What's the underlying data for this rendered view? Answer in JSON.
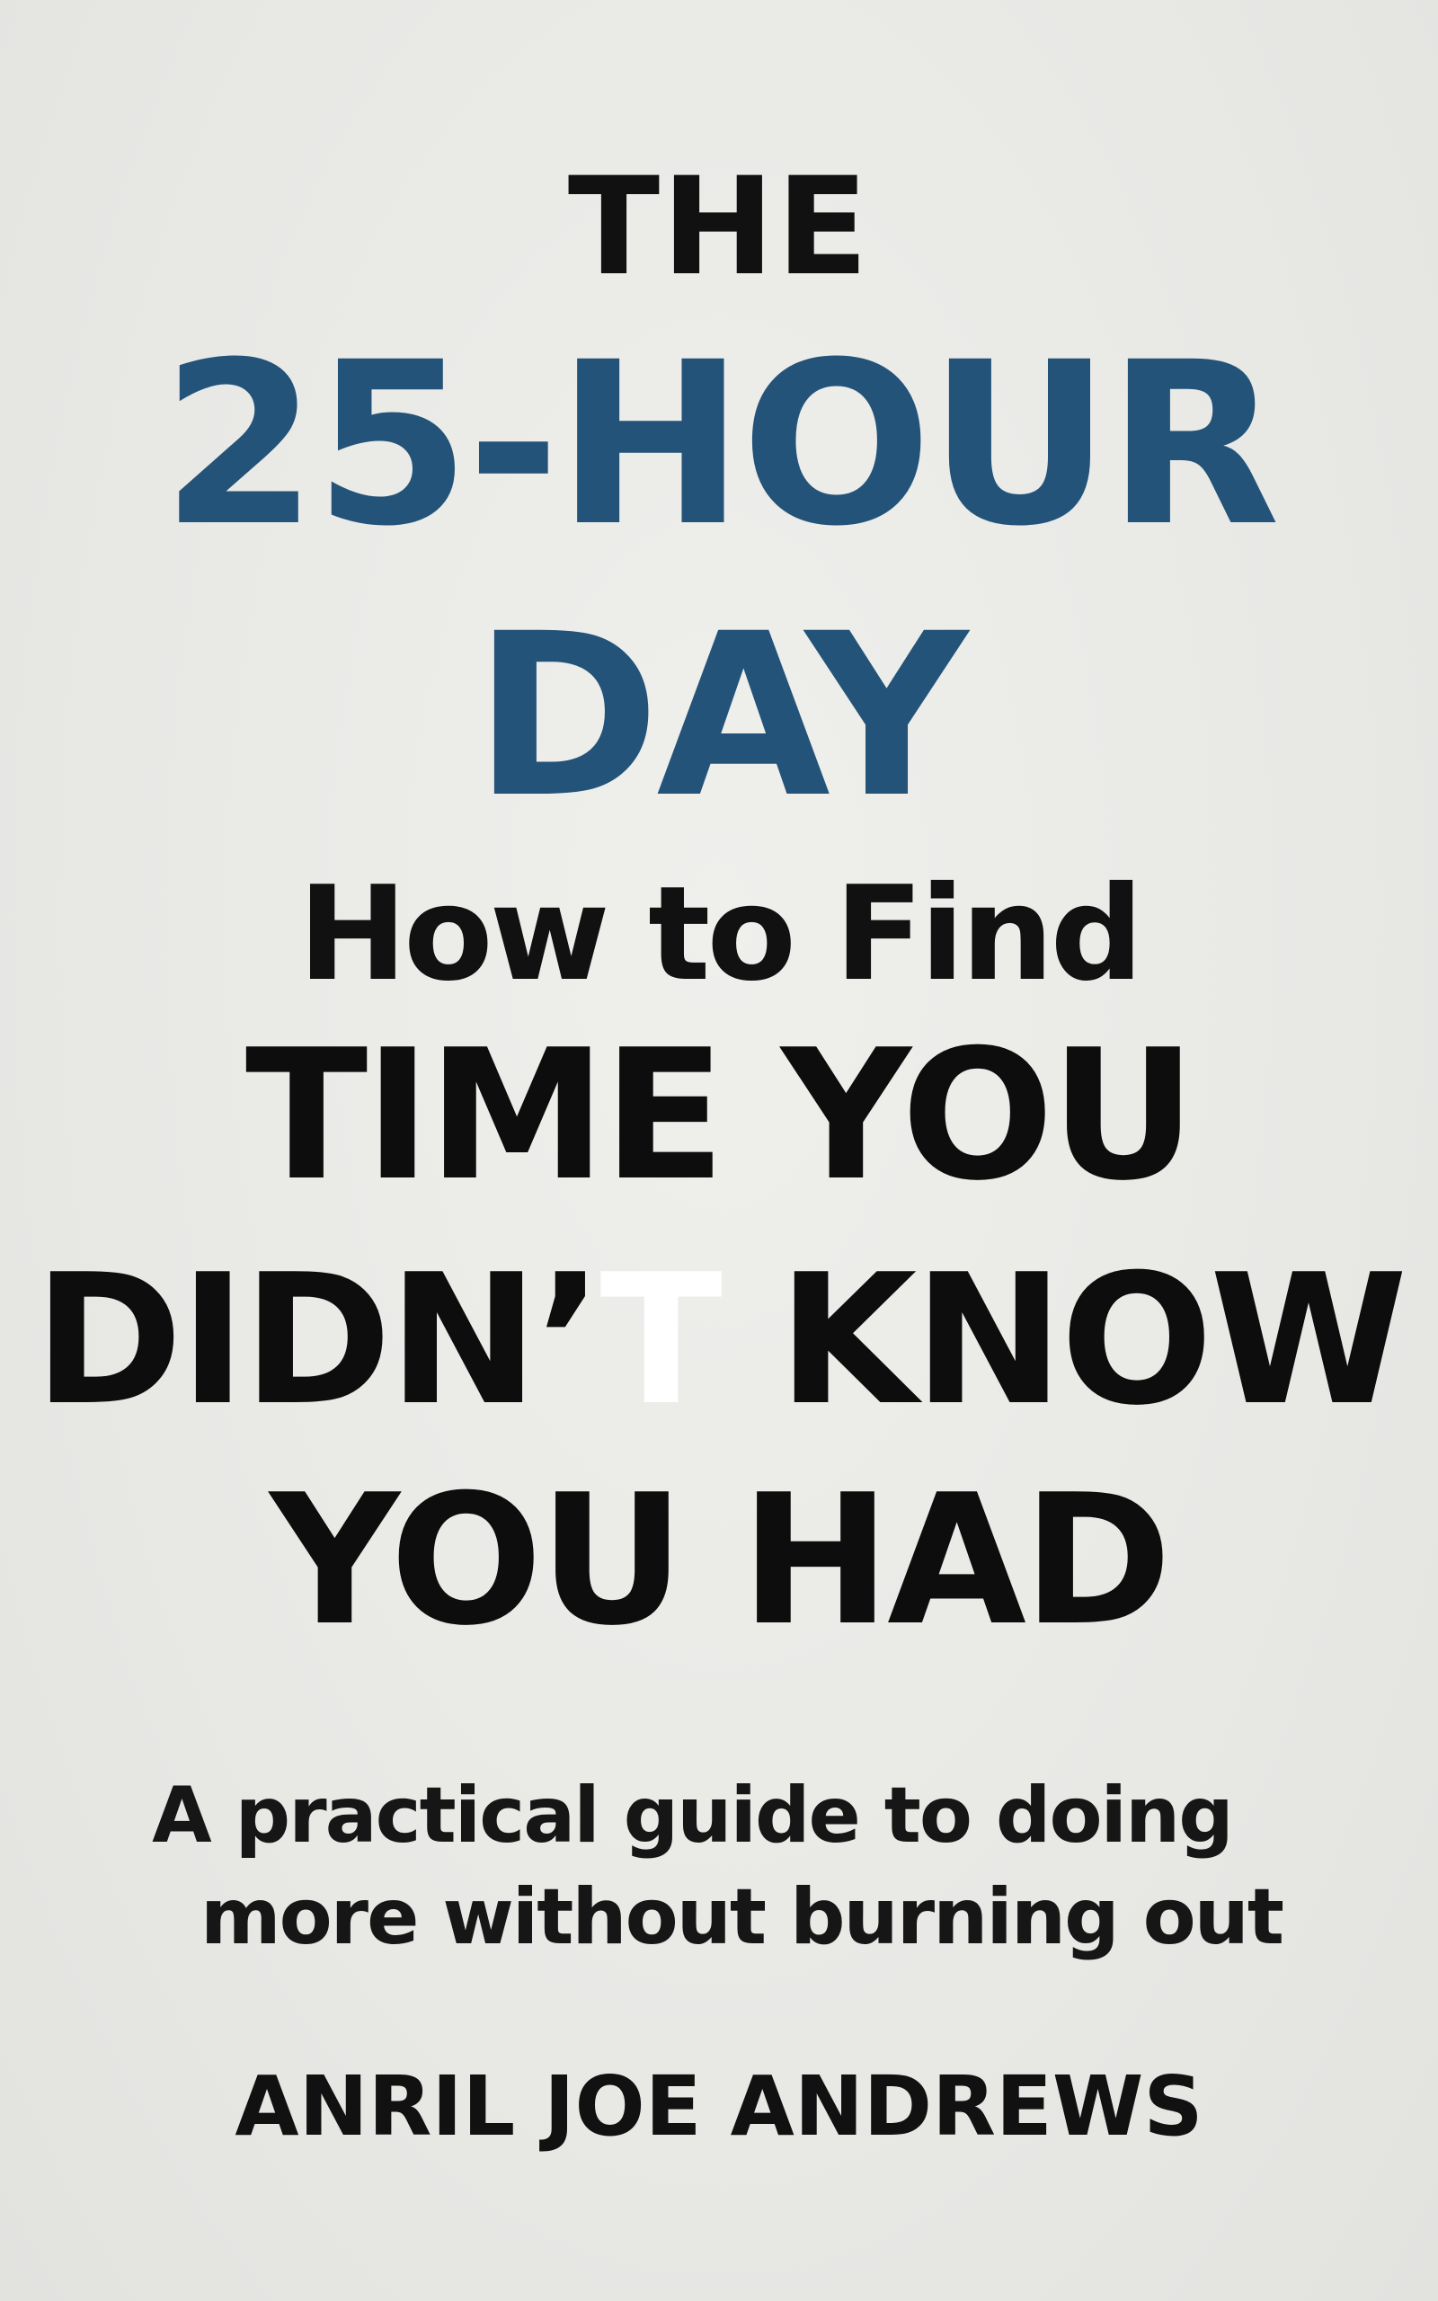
{
  "cover": {
    "title_line1": "THE",
    "title_line2": "25-HOUR",
    "title_line3": "DAY",
    "headline_line1": "How to Find",
    "headline_line2": "TIME YOU",
    "headline_line3_part1": "DIDN’",
    "headline_line3_part2": "T",
    "headline_line3_part3": " KNOW",
    "headline_line4": "YOU HAD",
    "subtitle_line1": "A practical guide to doing",
    "subtitle_line2": "more without burning out",
    "author": "ANRIL JOE ANDREWS"
  },
  "colors": {
    "background": "#e9e9e6",
    "title_accent": "#235378",
    "text": "#111111"
  }
}
